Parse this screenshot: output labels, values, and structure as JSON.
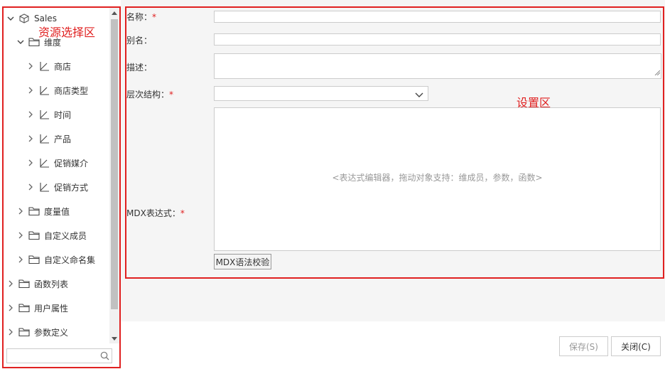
{
  "tree": {
    "root": {
      "label": "Sales",
      "icon": "cube-icon",
      "expanded": true
    },
    "items": [
      {
        "label": "维度",
        "icon": "folder-icon",
        "expanded": true,
        "level": 1
      },
      {
        "label": "商店",
        "icon": "hierarchy-icon",
        "expanded": false,
        "level": 2
      },
      {
        "label": "商店类型",
        "icon": "hierarchy-icon",
        "expanded": false,
        "level": 2
      },
      {
        "label": "时间",
        "icon": "hierarchy-icon",
        "expanded": false,
        "level": 2
      },
      {
        "label": "产品",
        "icon": "hierarchy-icon",
        "expanded": false,
        "level": 2
      },
      {
        "label": "促销媒介",
        "icon": "hierarchy-icon",
        "expanded": false,
        "level": 2
      },
      {
        "label": "促销方式",
        "icon": "hierarchy-icon",
        "expanded": false,
        "level": 2
      },
      {
        "label": "度量值",
        "icon": "folder-icon",
        "expanded": false,
        "level": 1
      },
      {
        "label": "自定义成员",
        "icon": "folder-icon",
        "expanded": false,
        "level": 1
      },
      {
        "label": "自定义命名集",
        "icon": "folder-icon",
        "expanded": false,
        "level": 1
      },
      {
        "label": "函数列表",
        "icon": "folder-icon",
        "expanded": false,
        "level": 0
      },
      {
        "label": "用户属性",
        "icon": "folder-icon",
        "expanded": false,
        "level": 0
      },
      {
        "label": "参数定义",
        "icon": "folder-icon",
        "expanded": false,
        "level": 0
      }
    ],
    "search": {
      "value": "",
      "placeholder": ""
    }
  },
  "annotations": {
    "resource_area": "资源选择区",
    "settings_area": "设置区"
  },
  "form": {
    "name_label": "名称：",
    "alias_label": "别名：",
    "desc_label": "描述：",
    "hierarchy_label": "层次结构：",
    "mdx_label": "MDX表达式：",
    "required_mark": "*",
    "name_value": "",
    "alias_value": "",
    "desc_value": "",
    "hierarchy_value": "",
    "mdx_placeholder": "<表达式编辑器，拖动对象支持：维成员，参数，函数>",
    "mdx_check_label": "MDX语法校验"
  },
  "footer": {
    "save_label": "保存(S)",
    "close_label": "关闭(C)"
  },
  "colors": {
    "annotation": "#e02020",
    "required": "#e02020",
    "disabled_text": "#999999"
  }
}
